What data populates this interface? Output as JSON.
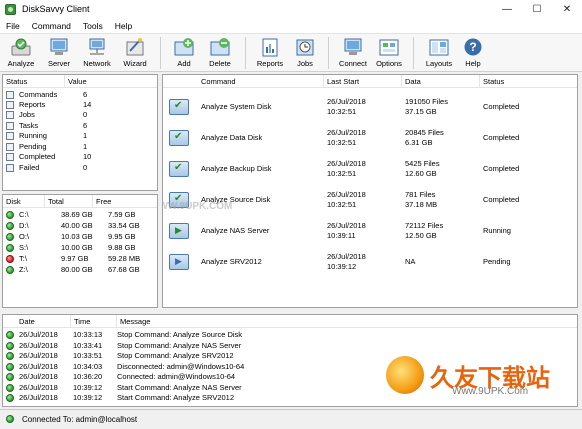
{
  "window": {
    "title": "DiskSavvy Client",
    "controls": [
      "—",
      "☐",
      "✕"
    ]
  },
  "menu": [
    "File",
    "Command",
    "Tools",
    "Help"
  ],
  "toolbar": {
    "buttons": [
      {
        "label": "Analyze",
        "icon": "analyze-icon"
      },
      {
        "label": "Server",
        "icon": "server-icon"
      },
      {
        "label": "Network",
        "icon": "network-icon"
      },
      {
        "label": "Wizard",
        "icon": "wizard-icon"
      },
      {
        "label": "Add",
        "icon": "add-icon"
      },
      {
        "label": "Delete",
        "icon": "delete-icon"
      },
      {
        "label": "Reports",
        "icon": "reports-icon"
      },
      {
        "label": "Jobs",
        "icon": "jobs-icon"
      },
      {
        "label": "Connect",
        "icon": "connect-icon"
      },
      {
        "label": "Options",
        "icon": "options-icon"
      },
      {
        "label": "Layouts",
        "icon": "layouts-icon"
      },
      {
        "label": "Help",
        "icon": "help-icon"
      }
    ]
  },
  "status_panel": {
    "headers": [
      "Status",
      "Value"
    ],
    "rows": [
      {
        "name": "Commands",
        "value": "6"
      },
      {
        "name": "Reports",
        "value": "14"
      },
      {
        "name": "Jobs",
        "value": "0"
      },
      {
        "name": "Tasks",
        "value": "6"
      },
      {
        "name": "Running",
        "value": "1"
      },
      {
        "name": "Pending",
        "value": "1"
      },
      {
        "name": "Completed",
        "value": "10"
      },
      {
        "name": "Failed",
        "value": "0"
      }
    ]
  },
  "disk_panel": {
    "headers": [
      "Disk",
      "Total",
      "Free"
    ],
    "rows": [
      {
        "disk": "C:\\",
        "total": "38.69 GB",
        "free": "7.59 GB",
        "state": "ok"
      },
      {
        "disk": "D:\\",
        "total": "40.00 GB",
        "free": "33.54 GB",
        "state": "ok"
      },
      {
        "disk": "O:\\",
        "total": "10.03 GB",
        "free": "9.95 GB",
        "state": "ok"
      },
      {
        "disk": "S:\\",
        "total": "10.00 GB",
        "free": "9.88 GB",
        "state": "ok"
      },
      {
        "disk": "T:\\",
        "total": "9.97 GB",
        "free": "59.28 MB",
        "state": "low"
      },
      {
        "disk": "Z:\\",
        "total": "80.00 GB",
        "free": "67.68 GB",
        "state": "ok"
      }
    ]
  },
  "command_panel": {
    "headers": [
      "Command",
      "Last Start",
      "Data",
      "Status"
    ],
    "rows": [
      {
        "command": "Analyze System Disk",
        "date": "26/Jul/2018",
        "time": "10:32:51",
        "data1": "191050 Files",
        "data2": "37.15 GB",
        "status": "Completed",
        "kind": "done"
      },
      {
        "command": "Analyze Data Disk",
        "date": "26/Jul/2018",
        "time": "10:32:51",
        "data1": "20845 Files",
        "data2": "6.31 GB",
        "status": "Completed",
        "kind": "done"
      },
      {
        "command": "Analyze Backup Disk",
        "date": "26/Jul/2018",
        "time": "10:32:51",
        "data1": "5425 Files",
        "data2": "12.60 GB",
        "status": "Completed",
        "kind": "done"
      },
      {
        "command": "Analyze Source Disk",
        "date": "26/Jul/2018",
        "time": "10:32:51",
        "data1": "781 Files",
        "data2": "37.18 MB",
        "status": "Completed",
        "kind": "done"
      },
      {
        "command": "Analyze NAS Server",
        "date": "26/Jul/2018",
        "time": "10:39:11",
        "data1": "72112 Files",
        "data2": "12.50 GB",
        "status": "Running",
        "kind": "run"
      },
      {
        "command": "Analyze SRV2012",
        "date": "26/Jul/2018",
        "time": "10:39:12",
        "data1": "NA",
        "data2": "",
        "status": "Pending",
        "kind": "pend"
      }
    ]
  },
  "log_panel": {
    "headers": [
      "Date",
      "Time",
      "Message"
    ],
    "rows": [
      {
        "date": "26/Jul/2018",
        "time": "10:33:13",
        "message": "Stop Command: Analyze Source Disk"
      },
      {
        "date": "26/Jul/2018",
        "time": "10:33:41",
        "message": "Stop Command: Analyze NAS Server"
      },
      {
        "date": "26/Jul/2018",
        "time": "10:33:51",
        "message": "Stop Command: Analyze SRV2012"
      },
      {
        "date": "26/Jul/2018",
        "time": "10:34:03",
        "message": "Disconnected: admin@Windows10-64"
      },
      {
        "date": "26/Jul/2018",
        "time": "10:36:20",
        "message": "Connected: admin@Windows10-64"
      },
      {
        "date": "26/Jul/2018",
        "time": "10:39:12",
        "message": "Start Command: Analyze NAS Server"
      },
      {
        "date": "26/Jul/2018",
        "time": "10:39:12",
        "message": "Start Command: Analyze SRV2012"
      }
    ]
  },
  "statusbar": {
    "text": "Connected To: admin@localhost"
  },
  "watermarks": {
    "main": "WWW.9UPK.COM",
    "logo_text": "久友下载站",
    "logo_sub": "Www.9UPK.Com"
  },
  "colors": {
    "ok": "#2f9a2f",
    "error": "#cc2020",
    "accent": "#3b6ea8",
    "logo": "#e8640c"
  }
}
